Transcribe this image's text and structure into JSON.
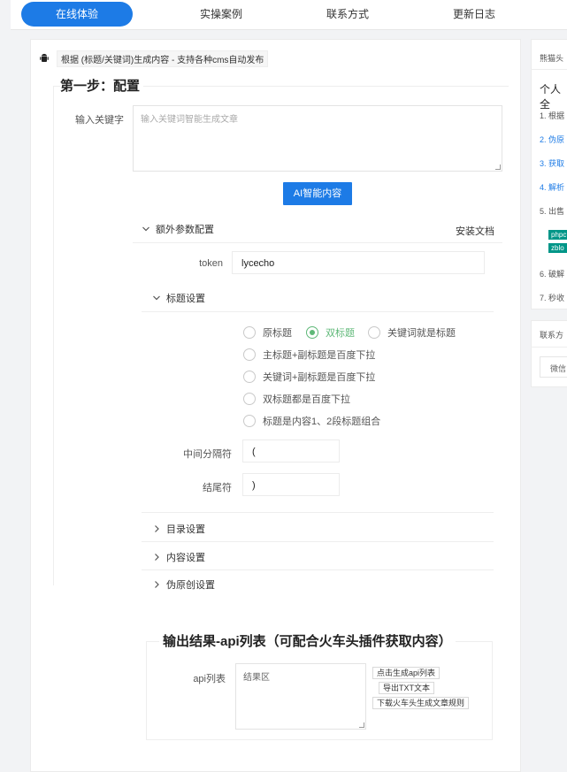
{
  "nav": {
    "items": [
      "在线体验",
      "实操案例",
      "联系方式",
      "更新日志"
    ],
    "active_index": 0
  },
  "colors": {
    "primary": "#1d7be6",
    "radio_checked": "#5fb878",
    "tag_green": "#009688"
  },
  "header": {
    "icon": "android-icon",
    "text": "根据 (标题/关键词)生成内容 - 支持各种cms自动发布"
  },
  "step1": {
    "title": "第一步：配置",
    "keyword_label": "输入关键字",
    "keyword_placeholder": "输入关键词智能生成文章",
    "generate_button": "AI智能内容",
    "extra_params_label": "额外参数配置",
    "install_doc_link": "安装文档",
    "token_label": "token",
    "token_value": "lycecho",
    "title_settings_label": "标题设置",
    "title_options": [
      {
        "label": "原标题",
        "checked": false
      },
      {
        "label": "双标题",
        "checked": true
      },
      {
        "label": "关键词就是标题",
        "checked": false
      },
      {
        "label": "主标题+副标题是百度下拉",
        "checked": false
      },
      {
        "label": "关键词+副标题是百度下拉",
        "checked": false
      },
      {
        "label": "双标题都是百度下拉",
        "checked": false
      },
      {
        "label": "标题是内容1、2段标题组合",
        "checked": false
      }
    ],
    "separator_label": "中间分隔符",
    "separator_value": "(",
    "end_label": "结尾符",
    "end_value": ")",
    "catalog_settings": "目录设置",
    "content_settings": "内容设置",
    "pseudo_original_settings": "伪原创设置"
  },
  "output": {
    "title": "输出结果-api列表（可配合火车头插件获取内容）",
    "api_label": "api列表",
    "result_placeholder": "结果区",
    "buttons": [
      "点击生成api列表",
      "导出TXT文本",
      "下载火车头生成文章规则"
    ]
  },
  "side": {
    "top_text": "熊猫头",
    "heading": "个人全",
    "items": [
      {
        "text": "1. 根据",
        "link": false
      },
      {
        "text": "2. 伪原",
        "link": true
      },
      {
        "text": "3. 获取",
        "link": true
      },
      {
        "text": "4. 解析",
        "link": true
      },
      {
        "text": "5. 出售",
        "link": false
      }
    ],
    "tags": [
      "phpc",
      "zblo"
    ],
    "items2": [
      "6. 破解",
      "7. 秒收"
    ],
    "contact_heading": "联系方",
    "contact_input": "微信"
  }
}
